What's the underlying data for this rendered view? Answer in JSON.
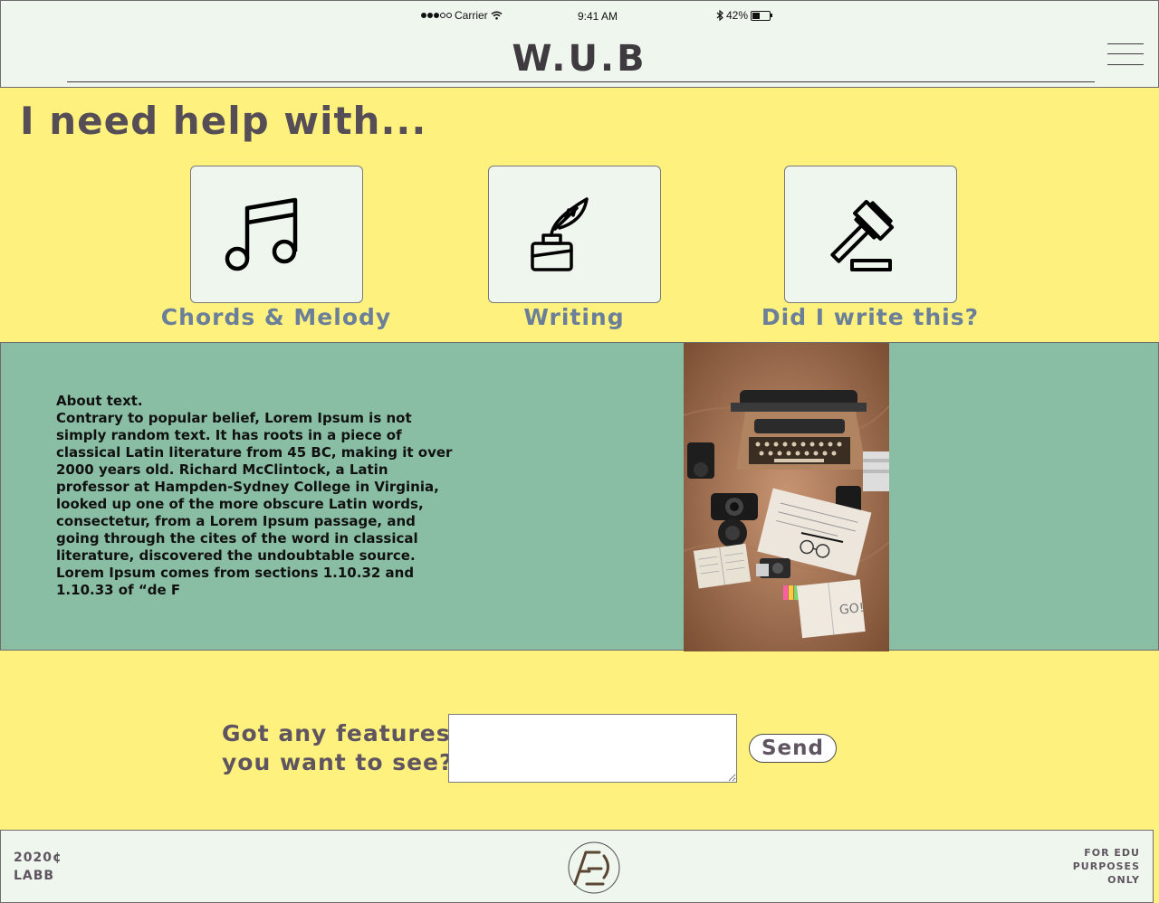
{
  "status_bar": {
    "carrier": "Carrier",
    "time": "9:41 AM",
    "battery": "42%",
    "battery_level": 0.42
  },
  "header": {
    "title": "W.U.B",
    "menu_icon": "hamburger-icon"
  },
  "help": {
    "heading": "I need help with...",
    "options": [
      {
        "label": "Chords & Melody",
        "icon": "music-note-icon"
      },
      {
        "label": "Writing",
        "icon": "quill-inkwell-icon"
      },
      {
        "label": "Did I write this?",
        "icon": "gavel-icon"
      }
    ]
  },
  "about": {
    "title": "About text.",
    "body": "Contrary to popular belief, Lorem Ipsum is not simply random text. It has roots in a piece of classical Latin literature from 45 BC, making it over 2000 years old. Richard McClintock, a Latin professor at Hampden-Sydney College in Virginia, looked up one of the more obscure Latin words, consectetur, from a Lorem Ipsum passage, and going through the cites of the word in classical literature, discovered the undoubtable source. Lorem Ipsum comes from sections 1.10.32 and 1.10.33 of “de F",
    "image": "typewriter-desk-photo"
  },
  "features": {
    "prompt_line1": "Got any features",
    "prompt_line2": "you want to see?",
    "input_value": "",
    "send_label": "Send"
  },
  "footer": {
    "year": "2020¢",
    "company": "LABB",
    "logo_text": "AE",
    "note_line1": "FOR EDU",
    "note_line2": "PURPOSES",
    "note_line3": "ONLY"
  },
  "colors": {
    "page_background": "#fff17d",
    "panel_background": "#eff6ee",
    "about_background": "#8abea4",
    "heading_text": "#564e56",
    "option_label": "#6b8098"
  }
}
